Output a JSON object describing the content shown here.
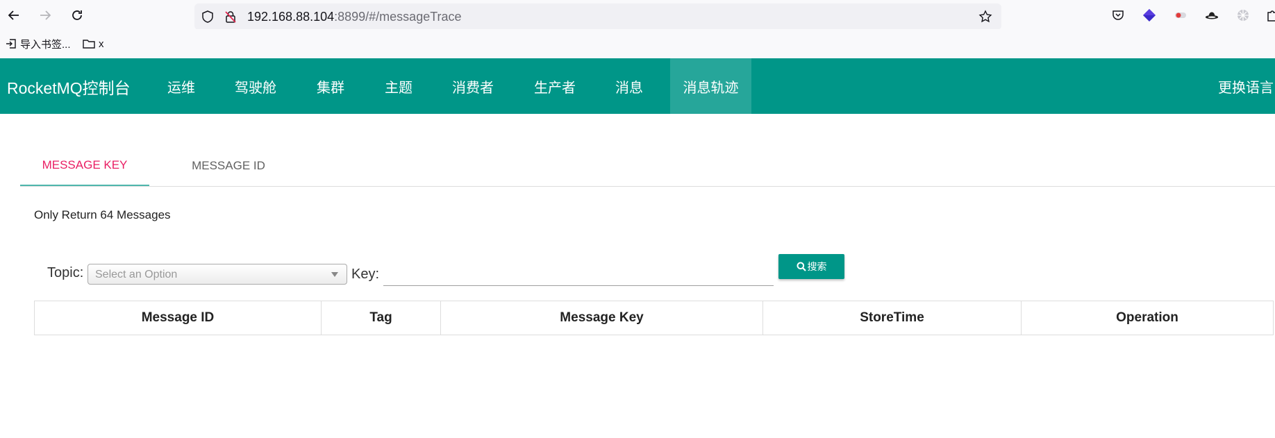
{
  "browser": {
    "url_host": "192.168.88.104",
    "url_rest": ":8899/#/messageTrace",
    "bookmarks": [
      {
        "label": "导入书签...",
        "icon": "import-icon"
      },
      {
        "label": "x",
        "icon": "folder-icon"
      }
    ]
  },
  "navbar": {
    "brand": "RocketMQ控制台",
    "items": [
      "运维",
      "驾驶舱",
      "集群",
      "主题",
      "消费者",
      "生产者",
      "消息",
      "消息轨迹"
    ],
    "active_item": "消息轨迹",
    "language": "更换语言",
    "color": "#009688"
  },
  "tabs": {
    "items": [
      "MESSAGE KEY",
      "MESSAGE ID"
    ],
    "active": "MESSAGE KEY",
    "active_color": "#e91e63"
  },
  "notice": "Only Return 64 Messages",
  "form": {
    "topic_label": "Topic:",
    "topic_placeholder": "Select an Option",
    "key_label": "Key:",
    "key_value": "",
    "search_label": "搜索"
  },
  "table": {
    "headers": [
      "Message ID",
      "Tag",
      "Message Key",
      "StoreTime",
      "Operation"
    ],
    "rows": []
  }
}
